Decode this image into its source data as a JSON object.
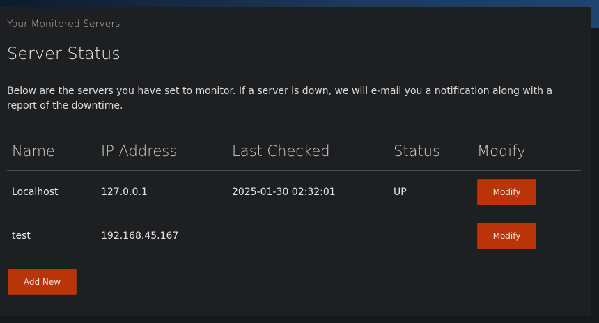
{
  "header": {
    "eyebrow": "Your Monitored Servers",
    "title": "Server Status",
    "description": "Below are the servers you have set to monitor. If a server is down, we will e-mail you a notification along with a report of the downtime."
  },
  "table": {
    "columns": [
      "Name",
      "IP Address",
      "Last Checked",
      "Status",
      "Modify"
    ],
    "rows": [
      {
        "name": "Localhost",
        "ip": "127.0.0.1",
        "last_checked": "2025-01-30 02:32:01",
        "status": "UP",
        "modify_label": "Modify"
      },
      {
        "name": "test",
        "ip": "192.168.45.167",
        "last_checked": "",
        "status": "",
        "modify_label": "Modify"
      }
    ]
  },
  "actions": {
    "add_new_label": "Add New"
  },
  "colors": {
    "accent_button": "#b83509",
    "panel_background": "#1e1f21",
    "page_background": "#16181b"
  }
}
